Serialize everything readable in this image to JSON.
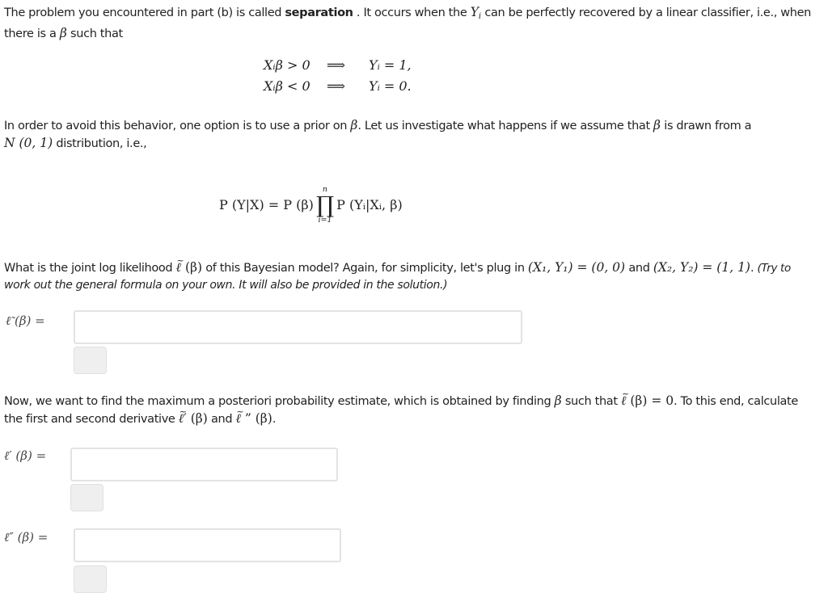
{
  "intro": {
    "line1_a": "The problem you encountered in part (b) is called ",
    "term": "separation",
    "line1_b": " . It occurs when the ",
    "Yi": "Y",
    "Yi_sub": "i",
    "line1_c": " can be perfectly recovered by a linear classifier, i.e., when",
    "line2_a": "there is a ",
    "beta": "β",
    "line2_b": " such that"
  },
  "separation_eq": {
    "rows": [
      {
        "lhs": "Xᵢβ > 0",
        "arrow": "⟹",
        "rhs": "Yᵢ = 1,"
      },
      {
        "lhs": "Xᵢβ < 0",
        "arrow": "⟹",
        "rhs": "Yᵢ = 0."
      }
    ]
  },
  "prior": {
    "line1_a": "In order to avoid this behavior, one option is to use a prior on ",
    "beta": "β",
    "line1_b": ". Let us investigate what happens if we assume that ",
    "line1_c": " is drawn from a",
    "dist": "N (0, 1)",
    "line2": " distribution, i.e.,"
  },
  "bayes_eq": {
    "lhs": "P (Y|X) = P (β)",
    "prod_top": "n",
    "prod_sym": "∏",
    "prod_bot": "i=1",
    "rhs": "P (Yᵢ|Xᵢ, β)"
  },
  "question1": {
    "text_a": "What is the joint log likelihood ",
    "ell": "ℓ",
    "arg": " (β)",
    "text_b": " of this Bayesian model? Again, for simplicity, let's plug in ",
    "pair1": "(X₁, Y₁) = (0, 0)",
    "and": " and ",
    "pair2": "(X₂, Y₂) = (1, 1)",
    "dot": ". ",
    "italic_a": "(Try to",
    "italic_b": "work out the general formula on your own. It will also be provided in the solution.)"
  },
  "answer1": {
    "label": "ℓ̃ (β) =",
    "value": ""
  },
  "question2": {
    "text_a": "Now, we want to find the maximum a posteriori probability estimate, which is obtained by finding ",
    "beta": "β",
    "text_b": " such that ",
    "cond": " (β) = 0",
    "text_c": ". To this end, calculate",
    "line2_a": "the first and second derivative ",
    "d1": "′ (β)",
    "and": " and ",
    "d2": " ” (β)",
    "end": "."
  },
  "answer2": {
    "label": "ℓ′ (β) =",
    "value": ""
  },
  "answer3": {
    "label": "ℓ″ (β) =",
    "value": ""
  }
}
